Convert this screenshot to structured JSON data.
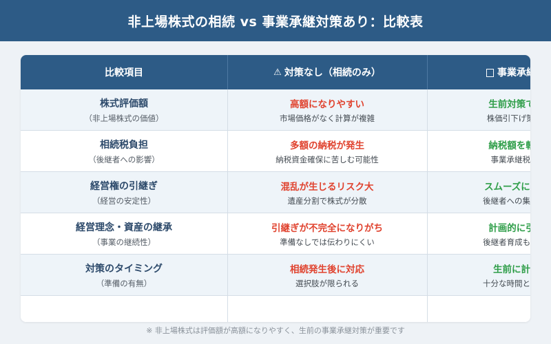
{
  "title": "非上場株式の相続 vs 事業承継対策あり：比較表",
  "headers": {
    "col1": "比較項目",
    "col2_icon": "⚠",
    "col2": "対策なし（相続のみ）",
    "col3": "事業承継対策あり"
  },
  "rows": [
    {
      "item": "株式評価額",
      "item_sub": "（非上場株式の価値）",
      "neg": "高額になりやすい",
      "neg_desc": "市場価格がなく計算が複雑",
      "pos": "生前対策で圧縮可能",
      "pos_desc": "株価引下げ策などを活用"
    },
    {
      "item": "相続税負担",
      "item_sub": "（後継者への影響）",
      "neg": "多額の納税が発生",
      "neg_desc": "納税資金確保に苦しむ可能性",
      "pos": "納税額を軽減できる",
      "pos_desc": "事業承継税制等を活用"
    },
    {
      "item": "経営権の引継ぎ",
      "item_sub": "（経営の安定性）",
      "neg": "混乱が生じるリスク大",
      "neg_desc": "遺産分割で株式が分散",
      "pos": "スムーズに移転できる",
      "pos_desc": "後継者への集中管理が可能"
    },
    {
      "item": "経営理念・資産の継承",
      "item_sub": "（事業の継続性）",
      "neg": "引継ぎが不完全になりがち",
      "neg_desc": "準備なしでは伝わりにくい",
      "pos": "計画的に引継ぎ可能",
      "pos_desc": "後継者育成も並行して実施"
    },
    {
      "item": "対策のタイミング",
      "item_sub": "（準備の有無）",
      "neg": "相続発生後に対応",
      "neg_desc": "選択肢が限られる",
      "pos": "生前に計画・実行",
      "pos_desc": "十分な時間と選択肢を確保"
    }
  ],
  "footnote": "※ 非上場株式は評価額が高額になりやすく、生前の事業承継対策が重要です",
  "colors": {
    "header_bg": "#2d5b86",
    "negative": "#e0432f",
    "positive": "#2f9e49",
    "row_alt": "#eef4f9"
  }
}
